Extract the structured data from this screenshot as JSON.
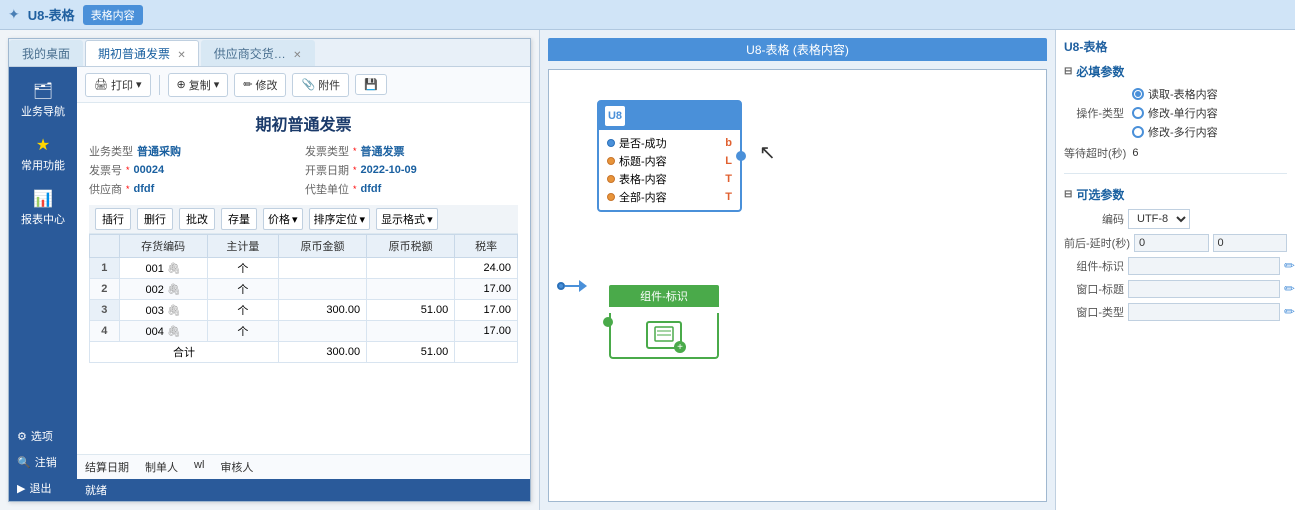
{
  "topbar": {
    "icon": "✦",
    "title": "U8-表格",
    "tag": "表格内容"
  },
  "tabs": [
    {
      "label": "我的桌面",
      "active": false
    },
    {
      "label": "期初普通发票",
      "active": true
    },
    {
      "label": "供应商交货…",
      "active": false
    }
  ],
  "sidebar": {
    "items": [
      {
        "label": "业务导航",
        "icon": "🗂"
      },
      {
        "label": "常用功能",
        "icon": "⭐"
      },
      {
        "label": "报表中心",
        "icon": "📊"
      }
    ],
    "bottom": [
      {
        "label": "选项",
        "icon": "⚙"
      },
      {
        "label": "注销",
        "icon": "🔍"
      },
      {
        "label": "退出",
        "icon": "🚪"
      }
    ]
  },
  "toolbar": {
    "print_label": "打印",
    "copy_label": "复制",
    "edit_label": "修改",
    "attach_label": "附件",
    "save_icon": "💾"
  },
  "invoice": {
    "title": "期初普通发票",
    "fields": [
      {
        "label": "业务类型",
        "value": "普通采购"
      },
      {
        "label": "发票类型",
        "required": true,
        "value": "普通发票"
      },
      {
        "label": "发票号",
        "required": true,
        "value": "00024"
      },
      {
        "label": "开票日期",
        "required": true,
        "value": "2022-10-09"
      },
      {
        "label": "供应商",
        "required": true,
        "value": "dfdf"
      },
      {
        "label": "代垫单位",
        "required": true,
        "value": "dfdf"
      }
    ]
  },
  "table_toolbar": {
    "insert_label": "插行",
    "delete_label": "删行",
    "batch_label": "批改",
    "stock_label": "存量",
    "price_label": "价格",
    "order_label": "排序定位",
    "display_label": "显示格式"
  },
  "table_headers": [
    "存货编码",
    "主计量",
    "原币金额",
    "原币税额",
    "税率"
  ],
  "table_rows": [
    {
      "num": 1,
      "code": "001",
      "unit": "个",
      "amount": "",
      "tax": "",
      "rate": "24.00"
    },
    {
      "num": 2,
      "code": "002",
      "unit": "个",
      "amount": "",
      "tax": "",
      "rate": "17.00"
    },
    {
      "num": 3,
      "code": "003",
      "unit": "个",
      "amount": "300.00",
      "tax": "51.00",
      "rate": "17.00"
    },
    {
      "num": 4,
      "code": "004",
      "unit": "个",
      "amount": "",
      "tax": "",
      "rate": "17.00"
    }
  ],
  "table_total": {
    "label": "合计",
    "amount": "300.00",
    "tax": "51.00"
  },
  "footer": {
    "balance_date_label": "结算日期",
    "creator_label": "制单人",
    "creator_value": "wl",
    "auditor_label": "审核人"
  },
  "status": "就绪",
  "flow": {
    "title": "U8-表格 (表格内容)",
    "node": {
      "title": "U8",
      "ports": [
        {
          "label": "是否-成功",
          "color": "blue"
        },
        {
          "label": "标题-内容",
          "color": "orange"
        },
        {
          "label": "表格-内容",
          "color": "orange"
        },
        {
          "label": "全部-内容",
          "color": "orange"
        }
      ]
    },
    "component_label": "组件-标识"
  },
  "right_panel": {
    "title": "U8-表格",
    "required_section": "必填参数",
    "operation_label": "操作-类型",
    "options": [
      {
        "label": "读取-表格内容",
        "selected": true
      },
      {
        "label": "修改-单行内容",
        "selected": false
      },
      {
        "label": "修改-多行内容",
        "selected": false
      }
    ],
    "timeout_label": "等待超时(秒)",
    "timeout_value": "6",
    "optional_section": "可选参数",
    "encoding_label": "编码",
    "encoding_value": "UTF-8",
    "delay_label": "前后-延时(秒)",
    "delay_left": "0",
    "delay_right": "0",
    "component_id_label": "组件-标识",
    "window_title_label": "窗口-标题",
    "window_type_label": "窗口-类型"
  }
}
